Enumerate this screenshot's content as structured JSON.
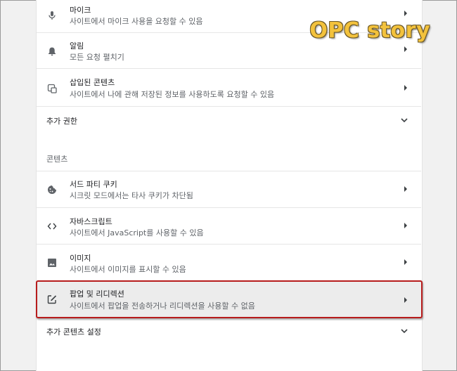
{
  "watermark": "OPC story",
  "permissions": [
    {
      "title": "마이크",
      "subtitle": "사이트에서 마이크 사용을 요청할 수 있음",
      "icon": "microphone-icon"
    },
    {
      "title": "알림",
      "subtitle": "모든 요청 펼치기",
      "icon": "bell-icon"
    },
    {
      "title": "삽입된 콘텐츠",
      "subtitle": "사이트에서 나에 관해 저장된 정보를 사용하도록 요청할 수 있음",
      "icon": "embedded-content-icon"
    }
  ],
  "additional_permissions_label": "추가 권한",
  "content_section_label": "콘텐츠",
  "content": [
    {
      "title": "서드 파티 쿠키",
      "subtitle": "시크릿 모드에서는 타사 쿠키가 차단됨",
      "icon": "cookie-icon"
    },
    {
      "title": "자바스크립트",
      "subtitle": "사이트에서 JavaScript를 사용할 수 있음",
      "icon": "code-icon"
    },
    {
      "title": "이미지",
      "subtitle": "사이트에서 이미지를 표시할 수 있음",
      "icon": "image-icon"
    },
    {
      "title": "팝업 및 리디렉션",
      "subtitle": "사이트에서 팝업을 전송하거나 리디렉션을 사용할 수 없음",
      "icon": "popup-icon",
      "highlighted": true
    }
  ],
  "additional_content_settings_label": "추가 콘텐츠 설정",
  "colors": {
    "highlight_border": "#b71c1c",
    "watermark": "#f3c23c"
  }
}
